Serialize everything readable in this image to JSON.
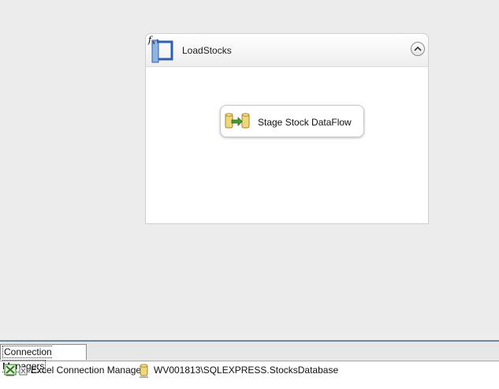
{
  "container": {
    "title": "LoadStocks",
    "icon": "sequence-container-icon",
    "collapse_icon": "chevron-up-icon"
  },
  "task": {
    "label": "Stage Stock DataFlow",
    "icon": "data-flow-task-icon"
  },
  "connection_managers": {
    "tab_label": "Connection Managers",
    "items": [
      {
        "label": "Excel Connection Manager",
        "icon": "excel-connection-icon"
      },
      {
        "label": "WV001813\\SQLEXPRESS.StocksDatabase",
        "icon": "database-connection-icon"
      }
    ]
  },
  "colors": {
    "canvas": "#ececec",
    "panel_border": "#6b86a8",
    "icon_blue": "#2f5fae",
    "icon_gold": "#e0c35a",
    "icon_green": "#4a9a2e"
  }
}
